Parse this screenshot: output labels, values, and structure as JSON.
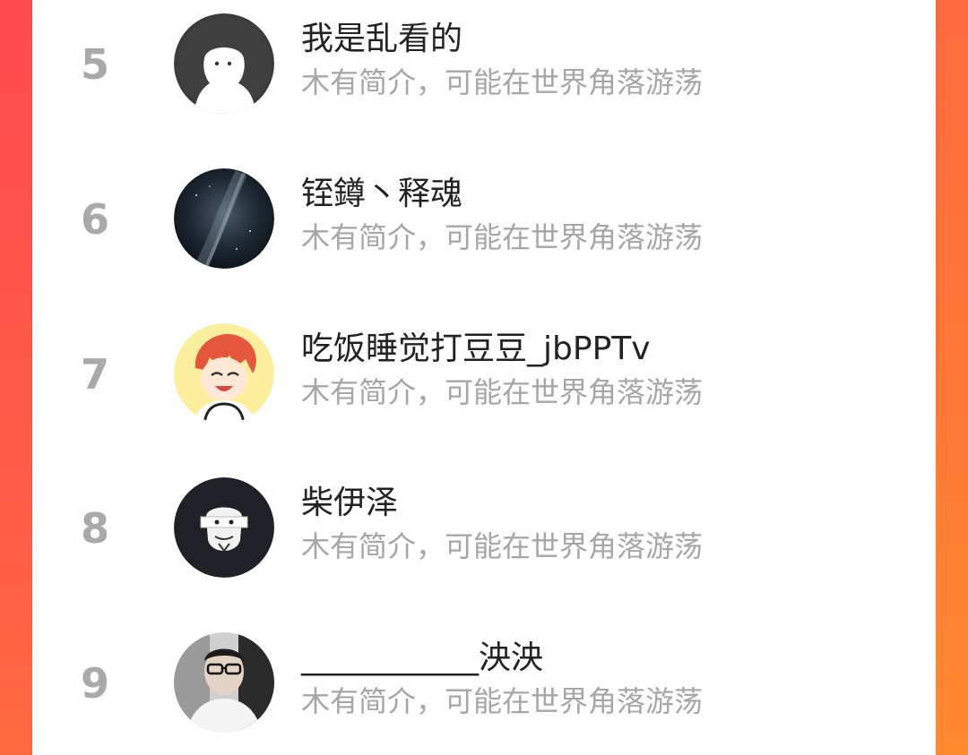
{
  "leaderboard": {
    "entries": [
      {
        "rank": "5",
        "name": "我是乱看的",
        "bio": "木有简介，可能在世界角落游荡",
        "avatar": "ghost-avatar-icon"
      },
      {
        "rank": "6",
        "name": "铚鐏丶释魂",
        "bio": "木有简介，可能在世界角落游荡",
        "avatar": "galaxy-avatar-icon"
      },
      {
        "rank": "7",
        "name": "吃饭睡觉打豆豆_jbPPTv",
        "bio": "木有简介，可能在世界角落游荡",
        "avatar": "anime-boy-avatar-icon"
      },
      {
        "rank": "8",
        "name": "柴伊泽",
        "bio": "木有简介，可能在世界角落游荡",
        "avatar": "mask-avatar-icon"
      },
      {
        "rank": "9",
        "name": "___________泱泱",
        "bio": "木有简介，可能在世界角落游荡",
        "avatar": "photo-avatar-icon"
      }
    ]
  },
  "colors": {
    "accent_left": "#ff4a4f",
    "accent_right": "#ff7a35",
    "rank": "#a9a9a9",
    "name": "#222222",
    "bio": "#a6a6a6"
  }
}
